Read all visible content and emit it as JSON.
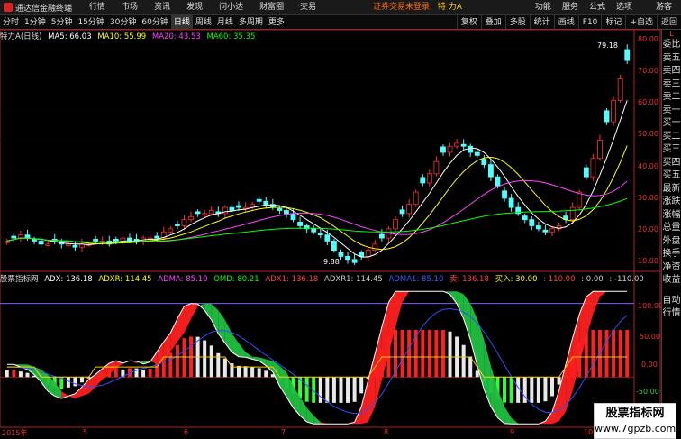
{
  "app": {
    "title": "通达信金融终端"
  },
  "menu": [
    "行情",
    "市场",
    "资讯",
    "发现",
    "问小达",
    "财富圈",
    "交易"
  ],
  "warning": "证券交易未登录",
  "stock_name": "特 力A",
  "right_menu": [
    "功能",
    "服务",
    "公式",
    "选项"
  ],
  "guest_label": "游客",
  "periods": [
    "分时",
    "1分钟",
    "5分钟",
    "15分钟",
    "30分钟",
    "60分钟",
    "日线",
    "周线",
    "月线",
    "多周期",
    "更多"
  ],
  "active_period": "日线",
  "tools": [
    "复权",
    "叠加",
    "多股",
    "统计",
    "画线",
    "F10",
    "标记",
    "+自选",
    "返回"
  ],
  "main_info": {
    "title": "特力A(日线)",
    "ma5": "MA5: 66.03",
    "ma10": "MA10: 55.99",
    "ma20": "MA20: 43.53",
    "ma60": "MA60: 35.35"
  },
  "ind_info": {
    "name": "股票指标网",
    "adx": "ADX: 136.18",
    "adxr": "ADXR: 114.45",
    "adma": "ADMA: 85.10",
    "omd": "OMD: 80.21",
    "adx1": "ADX1: 136.18",
    "adxr1": "ADXR1: 114.45",
    "adma1": "ADMA1: 85.10",
    "sell": "卖: 136.18",
    "buy": "买入: 30.00",
    "v1": ": 110.00",
    "v2": ": 0.00",
    "v3": ": -110.00"
  },
  "price_axis": [
    "80.00",
    "70.00",
    "60.00",
    "50.00",
    "40.00",
    "30.00",
    "20.00",
    "10.00"
  ],
  "ind_axis": [
    "100.00",
    "50.00",
    "0.00",
    "-50.00"
  ],
  "annot_high": "79.18",
  "annot_low": "9.88",
  "x_labels": [
    "2015年",
    "5",
    "6",
    "7",
    "8",
    "9",
    "10"
  ],
  "side_tabs": [
    "委比",
    "卖五",
    "卖四",
    "卖三",
    "卖二",
    "卖一",
    "买一",
    "买二",
    "买三",
    "买四",
    "买五",
    "最新",
    "涨跌",
    "涨幅",
    "总量",
    "外盘",
    "换手",
    "净资",
    "收益"
  ],
  "side_bottom": [
    "自动",
    "行情"
  ],
  "corner_badge": "L",
  "watermark": {
    "line1": "股票指标网",
    "line2": "www.7gpzb.com"
  },
  "chart_data": {
    "type": "candlestick",
    "price_range": [
      8,
      84
    ],
    "indicator_range": [
      -75,
      135
    ],
    "close": [
      17,
      18,
      19,
      18,
      17,
      16,
      16,
      17,
      16,
      16,
      15,
      16,
      16,
      17,
      17,
      16,
      17,
      18,
      17,
      17,
      18,
      18,
      18,
      20,
      21,
      22,
      24,
      25,
      26,
      26,
      27,
      26,
      28,
      27,
      28,
      28,
      29,
      30,
      29,
      28,
      27,
      26,
      24,
      22,
      21,
      20,
      19,
      17,
      14,
      12,
      11,
      10,
      12,
      14,
      16,
      18,
      21,
      24,
      26,
      29,
      33,
      36,
      39,
      43,
      46,
      48,
      49,
      48,
      46,
      45,
      42,
      38,
      35,
      31,
      28,
      26,
      24,
      22,
      21,
      20,
      21,
      22,
      24,
      28,
      33,
      38,
      44,
      50,
      56,
      63,
      70,
      76
    ],
    "ma_colors": {
      "ma5": "#ffffff",
      "ma10": "#ffff00",
      "ma20": "#ff44ff",
      "ma60": "#00ff00"
    }
  }
}
